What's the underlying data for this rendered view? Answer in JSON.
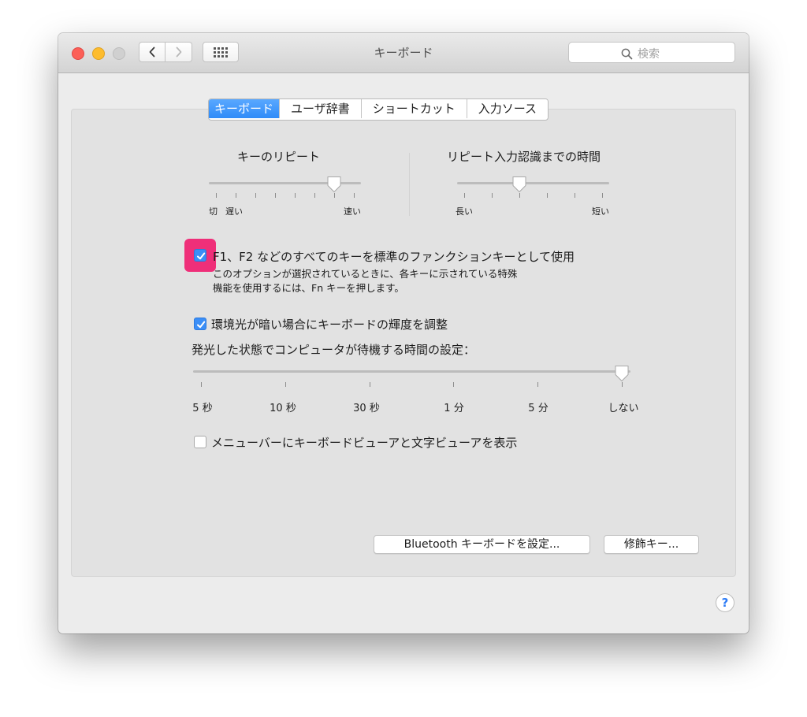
{
  "window": {
    "title": "キーボード"
  },
  "search": {
    "placeholder": "検索"
  },
  "tabs": [
    {
      "label": "キーボード",
      "active": true
    },
    {
      "label": "ユーザ辞書",
      "active": false
    },
    {
      "label": "ショートカット",
      "active": false
    },
    {
      "label": "入力ソース",
      "active": false
    }
  ],
  "key_repeat": {
    "title": "キーのリピート",
    "label_off": "切",
    "label_slow": "遅い",
    "label_fast": "速い",
    "tick_count": 8,
    "value_index": 6
  },
  "repeat_delay": {
    "title": "リピート入力認識までの時間",
    "label_long": "長い",
    "label_short": "短い",
    "tick_count": 6,
    "value_index": 2
  },
  "fn_keys": {
    "checked": true,
    "label": "F1、F2 などのすべてのキーを標準のファンクションキーとして使用",
    "description_line1": "このオプションが選択されているときに、各キーに示されている特殊",
    "description_line2": "機能を使用するには、Fn キーを押します。"
  },
  "brightness": {
    "checked": true,
    "label": "環境光が暗い場合にキーボードの輝度を調整"
  },
  "backlight_timeout": {
    "title": "発光した状態でコンピュータが待機する時間の設定：",
    "ticks": [
      "5 秒",
      "10 秒",
      "30 秒",
      "1 分",
      "5 分",
      "しない"
    ],
    "value_index": 5
  },
  "menubar_viewer": {
    "checked": false,
    "label": "メニューバーにキーボードビューアと文字ビューアを表示"
  },
  "buttons": {
    "bluetooth": "Bluetooth キーボードを設定...",
    "modifier": "修飾キー..."
  },
  "help": {
    "label": "?"
  },
  "colors": {
    "accent": "#3a8ef7",
    "highlight": "#ef2f79"
  }
}
